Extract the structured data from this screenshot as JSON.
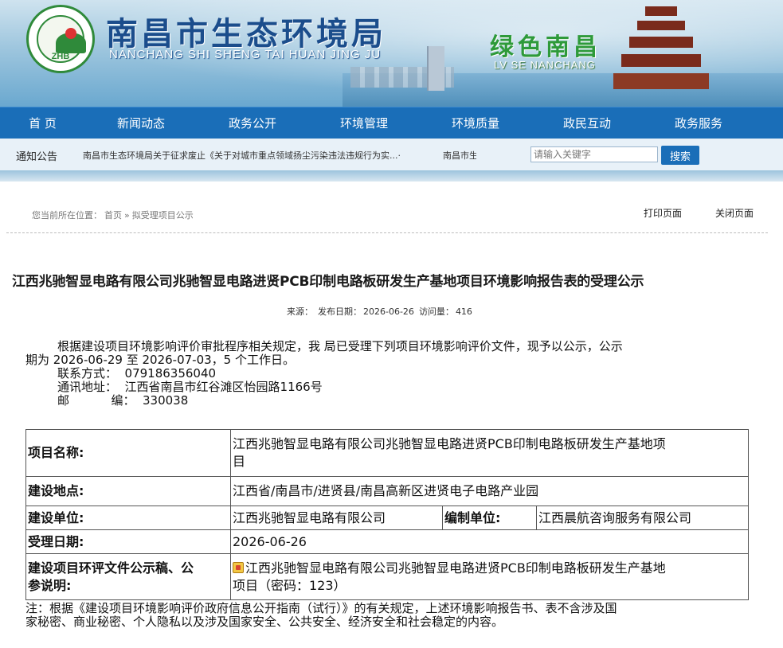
{
  "header": {
    "site_title": "南昌市生态环境局",
    "site_subtitle": "NANCHANG SHI SHENG TAI HUAN JING JU",
    "logo_text": "ZHB",
    "slogan": "绿色南昌",
    "slogan_sub": "LV SE NANCHANG"
  },
  "nav": {
    "items": [
      "首 页",
      "新闻动态",
      "政务公开",
      "环境管理",
      "环境质量",
      "政民互动",
      "政务服务"
    ]
  },
  "notice": {
    "label": "通知公告",
    "text": "南昌市生态环境局关于征求废止《关于对城市重点领域扬尘污染违法违规行为实...·",
    "text2": "南昌市生态环境局"
  },
  "search": {
    "placeholder": "请输入关键字",
    "button": "搜索"
  },
  "breadcrumb": {
    "prefix": "您当前所在位置：",
    "home": "首页",
    "separator": "»",
    "current": "拟受理项目公示"
  },
  "actions": {
    "print": "打印页面",
    "close": "关闭页面"
  },
  "article": {
    "title": "江西兆驰智显电路有限公司兆驰智显电路进贤PCB印制电路板研发生产基地项目环境影响报告表的受理公示",
    "source_label": "来源：",
    "date_label": "发布日期：",
    "date": "2026-06-26",
    "views_label": "访问量：",
    "views": "416",
    "para1_line1": "根据建设项目环境影响评价审批程序相关规定，我 局已受理下列项目环境影响评价文件，现予以公示，公示",
    "para1_line2": "期为 2026-06-29 至 2026-07-03，5 个工作日。",
    "contact": "联系方式：  079186356040",
    "address": "通讯地址：  江西省南昌市红谷滩区怡园路1166号",
    "postcode": "邮           编：  330038"
  },
  "table": {
    "project_name_label": "项目名称:",
    "project_name_l1": "江西兆驰智显电路有限公司兆驰智显电路进贤PCB印制电路板研发生产基地项",
    "project_name_l2": "目",
    "location_label": "建设地点:",
    "location": "江西省/南昌市/进贤县/南昌高新区进贤电子电路产业园",
    "builder_label": "建设单位:",
    "builder": "江西兆驰智显电路有限公司",
    "compiler_label": "编制单位:",
    "compiler": "江西晨航咨询服务有限公司",
    "accept_date_label": "受理日期:",
    "accept_date": "2026-06-26",
    "doc_label_l1": "建设项目环评文件公示稿、公",
    "doc_label_l2": "参说明:",
    "doc_l1": "江西兆驰智显电路有限公司兆驰智显电路进贤PCB印制电路板研发生产基地",
    "doc_l2": "项目（密码：123）"
  },
  "footnote": {
    "line1": "注：根据《建设项目环境影响评价政府信息公开指南（试行）》的有关规定，上述环境影响报告书、表不含涉及国",
    "line2": "家秘密、商业秘密、个人隐私以及涉及国家安全、公共安全、经济安全和社会稳定的内容。"
  },
  "colors": {
    "nav_bg": "#1a6eb8",
    "title_blue": "#1b4d8c",
    "slogan_green": "#2e9a3a"
  }
}
